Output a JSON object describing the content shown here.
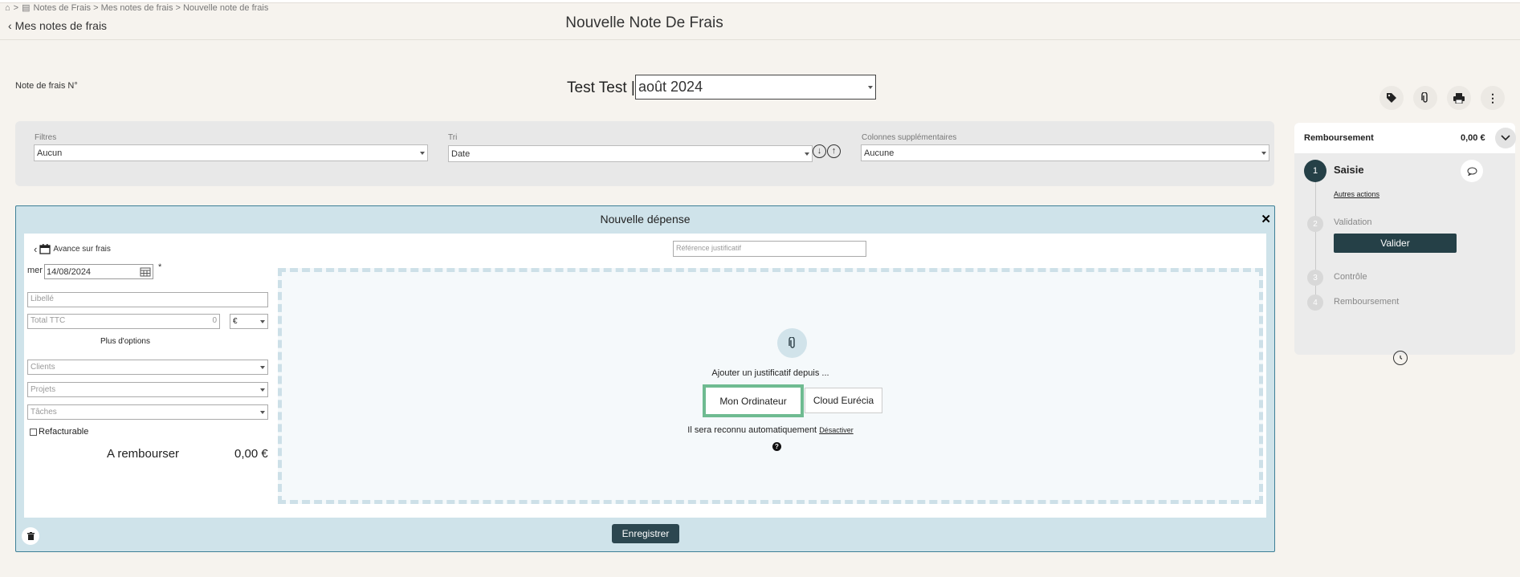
{
  "breadcrumb": {
    "home_icon": "home-icon",
    "separator": ">",
    "doc_icon": "document-icon",
    "path": "Notes de Frais > Mes notes de frais > Nouvelle note de frais"
  },
  "header": {
    "back_icon": "chevron-left-icon",
    "back_label": "Mes notes de frais",
    "title": "Nouvelle Note De Frais"
  },
  "note": {
    "number_label": "Note de frais N°",
    "owner": "Test Test |",
    "month": "août 2024"
  },
  "toolbar": {
    "icons": [
      "tag-icon",
      "paperclip-icon",
      "print-icon",
      "more-vertical-icon"
    ]
  },
  "filters": {
    "filter_label": "Filtres",
    "filter_value": "Aucun",
    "sort_label": "Tri",
    "sort_value": "Date",
    "sort_down_icon": "arrow-down-circle-icon",
    "sort_up_icon": "arrow-up-circle-icon",
    "columns_label": "Colonnes supplémentaires",
    "columns_value": "Aucune"
  },
  "modal": {
    "title": "Nouvelle dépense",
    "close_label": "✕",
    "advance_label": "Avance sur frais",
    "date_prefix": "mer",
    "date_value": "14/08/2024",
    "required_mark": "*",
    "libelle_placeholder": "Libellé",
    "total_placeholder": "Total TTC",
    "total_value": "0",
    "currency": "€",
    "more_options": "Plus d'options",
    "clients_placeholder": "Clients",
    "projects_placeholder": "Projets",
    "tasks_placeholder": "Tâches",
    "refacturable_label": "Refacturable",
    "to_reimburse_label": "A rembourser",
    "to_reimburse_value": "0,00 €",
    "ref_placeholder": "Référence justificatif",
    "add_text": "Ajouter un justificatif depuis ...",
    "computer_button": "Mon Ordinateur",
    "cloud_button": "Cloud Eurécia",
    "auto_text": "Il sera reconnu automatiquement",
    "deactivate_link": "Désactiver",
    "help_label": "?",
    "save_button": "Enregistrer"
  },
  "side": {
    "title": "Remboursement",
    "amount": "0,00 €",
    "other_actions": "Autres actions",
    "validate_button": "Valider",
    "steps": [
      {
        "number": "1",
        "label": "Saisie"
      },
      {
        "number": "2",
        "label": "Validation"
      },
      {
        "number": "3",
        "label": "Contrôle"
      },
      {
        "number": "4",
        "label": "Remboursement"
      }
    ]
  },
  "colors": {
    "accent_dark": "#254047",
    "modal_bg": "#cfe3ea",
    "highlight_green": "#6fbb91",
    "page_bg": "#f6f3ee"
  }
}
